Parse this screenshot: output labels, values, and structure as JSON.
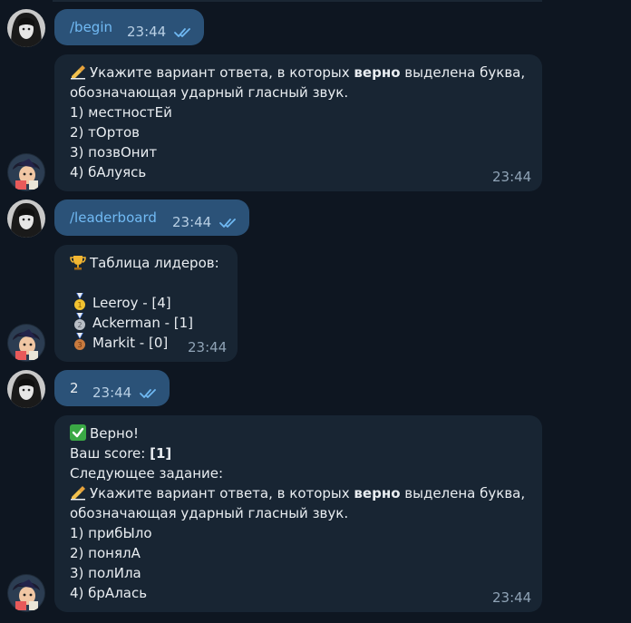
{
  "messages": {
    "m1": {
      "text": "/begin",
      "time": "23:44"
    },
    "m2": {
      "prefix": "Укажите вариант ответа, в которых ",
      "bold": "верно",
      "suffix": " выделена буква,",
      "line2": "обозначающая ударный гласный звук.",
      "options": [
        "1) местностЕй",
        "2) тОртов",
        "3) позвОнит",
        "4) бАлуясь"
      ],
      "time": "23:44"
    },
    "m3": {
      "text": "/leaderboard",
      "time": "23:44"
    },
    "m4": {
      "title": "Таблица лидеров:",
      "rows": [
        "Leeroy - [4]",
        "Ackerman - [1]",
        "Markit - [0]"
      ],
      "time": "23:44"
    },
    "m5": {
      "text": "2",
      "time": "23:44"
    },
    "m6": {
      "line1": "Верно!",
      "score_label": "Ваш score: ",
      "score_value": "[1]",
      "next": "Следующее задание:",
      "prefix": "Укажите вариант ответа, в которых ",
      "bold": "верно",
      "suffix": " выделена буква,",
      "line2": "обозначающая ударный гласный звук.",
      "options": [
        "1) прибЫло",
        "2) понялА",
        "3) полИла",
        "4) брАлась"
      ],
      "time": "23:44"
    }
  },
  "colors": {
    "background": "#0e1621",
    "outgoing_bubble": "#2b5278",
    "incoming_bubble": "#182533",
    "link": "#71baf4",
    "read_ticks": "#6fb8f2"
  },
  "icons": {
    "user_avatar": "dark-haired-girl-avatar",
    "bot_avatar": "anime-bot-avatar",
    "ticks": "double-check-icon",
    "writing": "writing-hand-icon",
    "trophy": "trophy-icon",
    "check": "check-mark-button-icon",
    "medals": [
      "gold-medal-icon",
      "silver-medal-icon",
      "bronze-medal-icon"
    ]
  }
}
